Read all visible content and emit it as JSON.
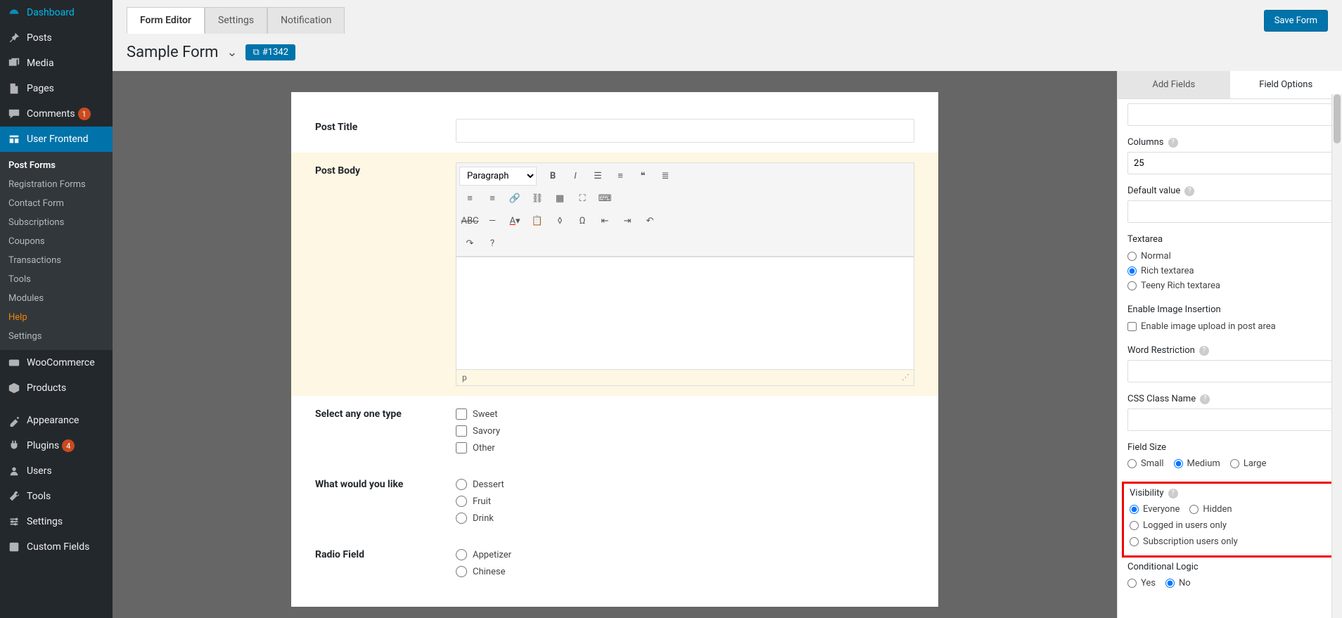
{
  "sidebar": {
    "main": [
      {
        "label": "Dashboard",
        "icon": "dashboard"
      },
      {
        "label": "Posts",
        "icon": "pin"
      },
      {
        "label": "Media",
        "icon": "media"
      },
      {
        "label": "Pages",
        "icon": "page"
      },
      {
        "label": "Comments",
        "icon": "comment",
        "badge": "1"
      },
      {
        "label": "User Frontend",
        "icon": "uf",
        "active": true
      }
    ],
    "sub": [
      {
        "label": "Post Forms",
        "current": true
      },
      {
        "label": "Registration Forms"
      },
      {
        "label": "Contact Form"
      },
      {
        "label": "Subscriptions"
      },
      {
        "label": "Coupons"
      },
      {
        "label": "Transactions"
      },
      {
        "label": "Tools"
      },
      {
        "label": "Modules"
      },
      {
        "label": "Help",
        "highlight": true
      },
      {
        "label": "Settings"
      }
    ],
    "lower": [
      {
        "label": "WooCommerce",
        "icon": "woo"
      },
      {
        "label": "Products",
        "icon": "products"
      },
      {
        "label": "Appearance",
        "icon": "appearance"
      },
      {
        "label": "Plugins",
        "icon": "plugins",
        "badge": "4"
      },
      {
        "label": "Users",
        "icon": "users"
      },
      {
        "label": "Tools",
        "icon": "tools"
      },
      {
        "label": "Settings",
        "icon": "settings"
      },
      {
        "label": "Custom Fields",
        "icon": "custom"
      }
    ]
  },
  "tabs": {
    "form_editor": "Form Editor",
    "settings": "Settings",
    "notification": "Notification"
  },
  "save_label": "Save Form",
  "form": {
    "title": "Sample Form",
    "id_chip": "#1342"
  },
  "fields": {
    "post_title": {
      "label": "Post Title"
    },
    "post_body": {
      "label": "Post Body",
      "paragraph_label": "Paragraph",
      "status": "p"
    },
    "select_type": {
      "label": "Select any one type",
      "options": [
        "Sweet",
        "Savory",
        "Other"
      ]
    },
    "what_like": {
      "label": "What would you like",
      "options": [
        "Dessert",
        "Fruit",
        "Drink"
      ]
    },
    "radio": {
      "label": "Radio Field",
      "options": [
        "Appetizer",
        "Chinese"
      ]
    }
  },
  "right": {
    "tab_add": "Add Fields",
    "tab_opts": "Field Options",
    "columns": {
      "label": "Columns",
      "value": "25"
    },
    "default_value": {
      "label": "Default value"
    },
    "textarea": {
      "label": "Textarea",
      "opts": [
        "Normal",
        "Rich textarea",
        "Teeny Rich textarea"
      ],
      "selected": "Rich textarea"
    },
    "img_insert": {
      "label": "Enable Image Insertion",
      "chk": "Enable image upload in post area"
    },
    "word_restrict": {
      "label": "Word Restriction"
    },
    "css_class": {
      "label": "CSS Class Name"
    },
    "field_size": {
      "label": "Field Size",
      "opts": [
        "Small",
        "Medium",
        "Large"
      ],
      "selected": "Medium"
    },
    "visibility": {
      "label": "Visibility",
      "opts": [
        "Everyone",
        "Hidden",
        "Logged in users only",
        "Subscription users only"
      ],
      "selected": "Everyone"
    },
    "cond_logic": {
      "label": "Conditional Logic",
      "opts": [
        "Yes",
        "No"
      ],
      "selected": "No"
    }
  }
}
